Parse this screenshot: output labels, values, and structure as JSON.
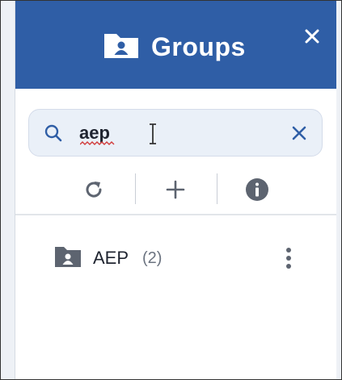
{
  "header": {
    "title": "Groups",
    "folder_icon": "folder-user-icon",
    "close_icon": "close-icon"
  },
  "search": {
    "value": "aep",
    "search_icon": "search-icon",
    "clear_icon": "clear-icon"
  },
  "toolbar": {
    "buttons": [
      {
        "icon": "refresh-icon"
      },
      {
        "icon": "plus-icon"
      },
      {
        "icon": "info-icon"
      }
    ]
  },
  "list": {
    "items": [
      {
        "name": "AEP",
        "count": "(2)",
        "icon": "folder-user-icon"
      }
    ]
  },
  "colors": {
    "header_bg": "#2f5ea6",
    "search_bg": "#eaf0f8",
    "icon_grey": "#5d6470",
    "accent": "#2f5ea6"
  }
}
